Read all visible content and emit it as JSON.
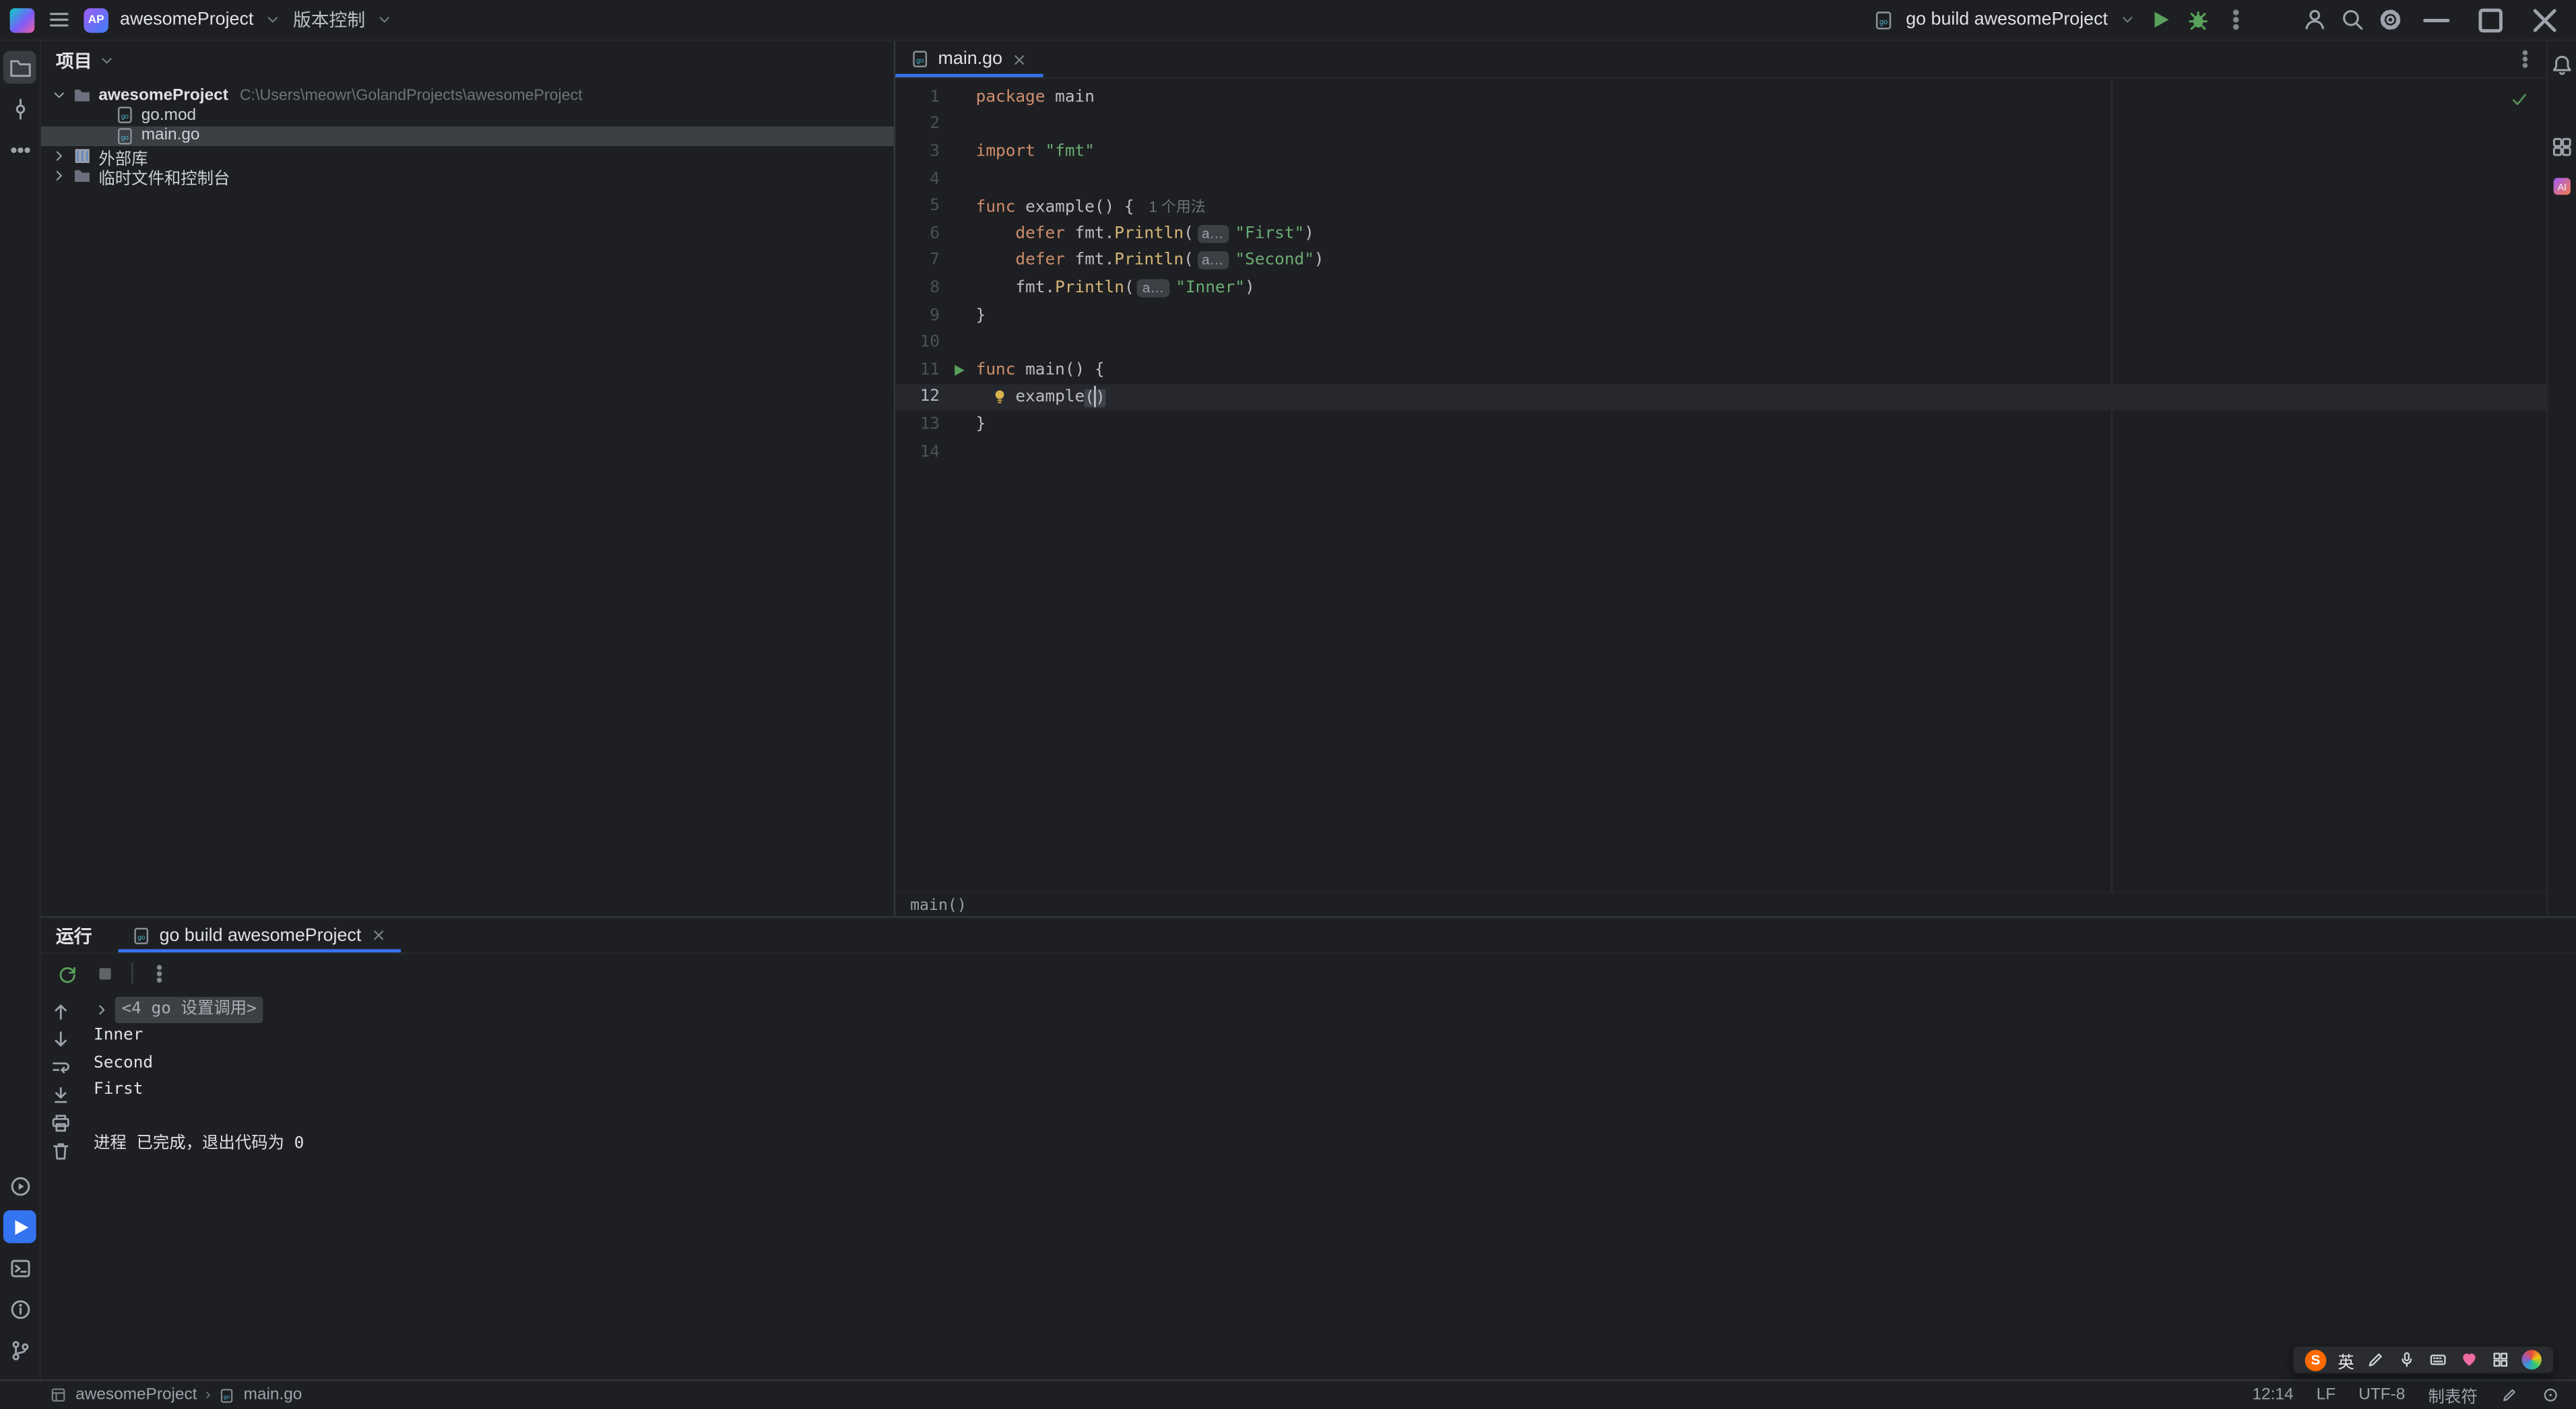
{
  "colors": {
    "accent": "#3574f0",
    "keyword": "#cf8e6d",
    "string": "#6aab73",
    "function": "#d5b778",
    "run_green": "#58a15c",
    "check_green": "#57965c",
    "bulb_yellow": "#d8b44c",
    "sogou_orange": "#ff6a00",
    "heart_pink": "#ed6ba3"
  },
  "titlebar": {
    "project_badge": "AP",
    "project_name": "awesomeProject",
    "vcs_menu": "版本控制",
    "run_config": "go build awesomeProject"
  },
  "project_panel": {
    "title": "项目",
    "tree": [
      {
        "id": "awesome-project-root",
        "label": "awesomeProject",
        "path": "C:\\Users\\meowr\\GolandProjects\\awesomeProject",
        "indent": 0,
        "chevron": "down",
        "icon": "folder",
        "bold": true
      },
      {
        "id": "go-mod",
        "label": "go.mod",
        "indent": 1,
        "icon": "go-file"
      },
      {
        "id": "main-go",
        "label": "main.go",
        "indent": 1,
        "icon": "go-file",
        "selected": true
      },
      {
        "id": "external-libraries",
        "label": "外部库",
        "indent": 0,
        "chevron": "right",
        "icon": "library"
      },
      {
        "id": "scratches-consoles",
        "label": "临时文件和控制台",
        "indent": 0,
        "chevron": "right",
        "icon": "scratch"
      }
    ]
  },
  "editor": {
    "tabs": [
      {
        "label": "main.go"
      }
    ],
    "breadcrumb": "main()",
    "inlays": {
      "param_hint": "a…",
      "usages_hint": "1 个用法"
    },
    "lines": [
      {
        "n": 1,
        "tokens": [
          {
            "c": "kw",
            "t": "package"
          },
          {
            "c": "pl",
            "t": " main"
          }
        ]
      },
      {
        "n": 2,
        "tokens": []
      },
      {
        "n": 3,
        "tokens": [
          {
            "c": "kw",
            "t": "import"
          },
          {
            "c": "pl",
            "t": " "
          },
          {
            "c": "str",
            "t": "\"fmt\""
          }
        ]
      },
      {
        "n": 4,
        "tokens": []
      },
      {
        "n": 5,
        "tokens": [
          {
            "c": "kw",
            "t": "func"
          },
          {
            "c": "pl",
            "t": " example() {"
          },
          {
            "c": "hint",
            "t": "1 个用法"
          }
        ]
      },
      {
        "n": 6,
        "tokens": [
          {
            "c": "pl",
            "t": "    "
          },
          {
            "c": "kw",
            "t": "defer"
          },
          {
            "c": "pl",
            "t": " fmt."
          },
          {
            "c": "fn",
            "t": "Println"
          },
          {
            "c": "pl",
            "t": "("
          },
          {
            "c": "inlay",
            "t": "a…"
          },
          {
            "c": "str",
            "t": "\"First\""
          },
          {
            "c": "pl",
            "t": ")"
          }
        ]
      },
      {
        "n": 7,
        "tokens": [
          {
            "c": "pl",
            "t": "    "
          },
          {
            "c": "kw",
            "t": "defer"
          },
          {
            "c": "pl",
            "t": " fmt."
          },
          {
            "c": "fn",
            "t": "Println"
          },
          {
            "c": "pl",
            "t": "("
          },
          {
            "c": "inlay",
            "t": "a…"
          },
          {
            "c": "str",
            "t": "\"Second\""
          },
          {
            "c": "pl",
            "t": ")"
          }
        ]
      },
      {
        "n": 8,
        "tokens": [
          {
            "c": "pl",
            "t": "    fmt."
          },
          {
            "c": "fn",
            "t": "Println"
          },
          {
            "c": "pl",
            "t": "("
          },
          {
            "c": "inlay",
            "t": "a…"
          },
          {
            "c": "str",
            "t": "\"Inner\""
          },
          {
            "c": "pl",
            "t": ")"
          }
        ]
      },
      {
        "n": 9,
        "tokens": [
          {
            "c": "pl",
            "t": "}"
          }
        ]
      },
      {
        "n": 10,
        "tokens": []
      },
      {
        "n": 11,
        "run": true,
        "tokens": [
          {
            "c": "kw",
            "t": "func"
          },
          {
            "c": "pl",
            "t": " main() {"
          }
        ]
      },
      {
        "n": 12,
        "current": true,
        "bulb": true,
        "tokens": [
          {
            "c": "pl",
            "t": "    example"
          },
          {
            "c": "paren",
            "t": "("
          },
          {
            "c": "caret",
            "t": ""
          },
          {
            "c": "paren",
            "t": ")"
          }
        ]
      },
      {
        "n": 13,
        "tokens": [
          {
            "c": "pl",
            "t": "}"
          }
        ]
      },
      {
        "n": 14,
        "tokens": []
      }
    ]
  },
  "run_panel": {
    "tool_label": "运行",
    "tab_label": "go build awesomeProject",
    "console": [
      {
        "kind": "fold",
        "text": "<4 go 设置调用>"
      },
      {
        "kind": "out",
        "text": "Inner"
      },
      {
        "kind": "out",
        "text": "Second"
      },
      {
        "kind": "out",
        "text": "First"
      },
      {
        "kind": "out",
        "text": ""
      },
      {
        "kind": "out",
        "text": "进程 已完成，退出代码为 0"
      }
    ]
  },
  "statusbar": {
    "module": "awesomeProject",
    "file": "main.go",
    "cursor_position": "12:14",
    "line_ending": "LF",
    "encoding": "UTF-8",
    "indent_style": "制表符"
  },
  "ime_bar": {
    "logo": "S",
    "mode": "英"
  }
}
